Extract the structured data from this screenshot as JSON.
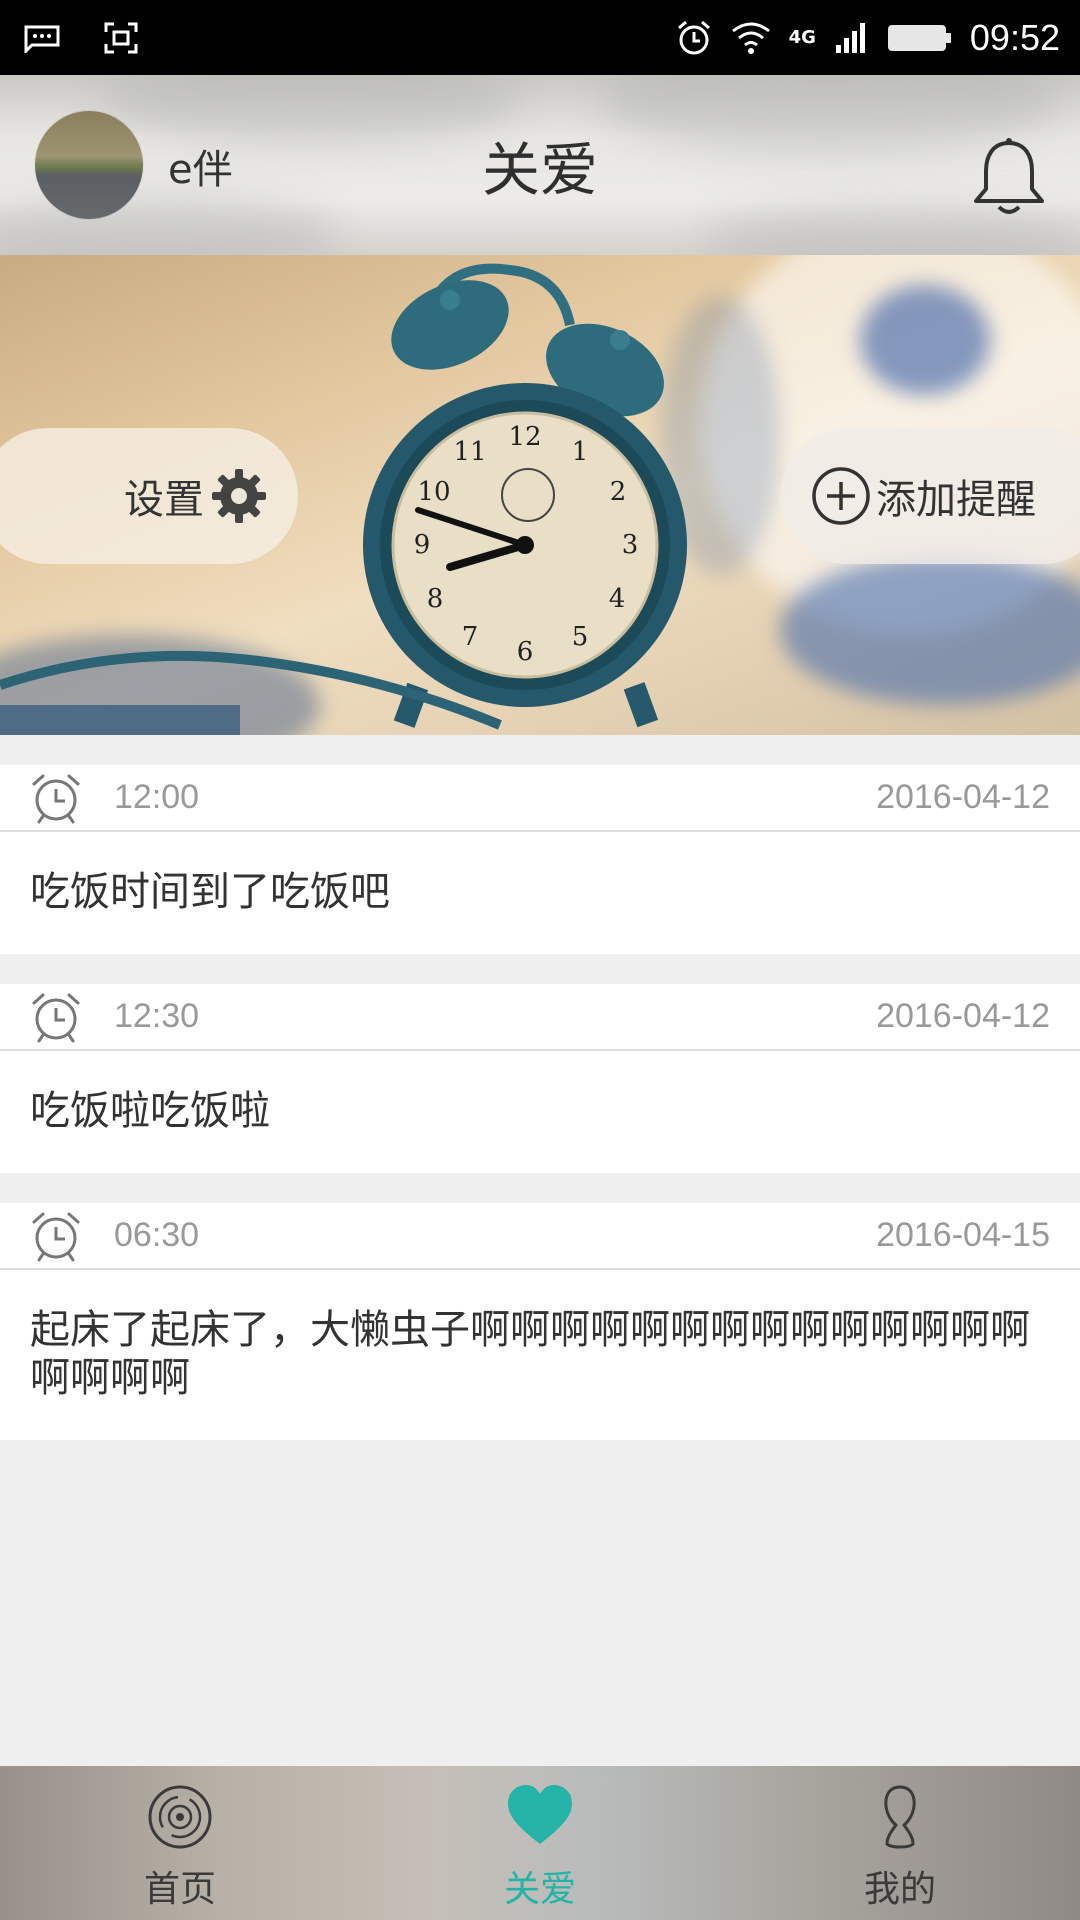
{
  "status_bar": {
    "time": "09:52",
    "network": "4G"
  },
  "header": {
    "username": "e伴",
    "title": "关爱"
  },
  "banner": {
    "settings_label": "设置",
    "add_reminder_label": "添加提醒"
  },
  "reminders": [
    {
      "time": "12:00",
      "date": "2016-04-12",
      "text": "吃饭时间到了吃饭吧"
    },
    {
      "time": "12:30",
      "date": "2016-04-12",
      "text": "吃饭啦吃饭啦"
    },
    {
      "time": "06:30",
      "date": "2016-04-15",
      "text": "起床了起床了，大懒虫子啊啊啊啊啊啊啊啊啊啊啊啊啊啊啊啊啊啊"
    }
  ],
  "bottom_nav": {
    "items": [
      {
        "label": "首页",
        "icon": "record-icon"
      },
      {
        "label": "关爱",
        "icon": "heart-icon"
      },
      {
        "label": "我的",
        "icon": "person-icon"
      }
    ],
    "active_index": 1,
    "accent_color": "#24b3a6"
  }
}
